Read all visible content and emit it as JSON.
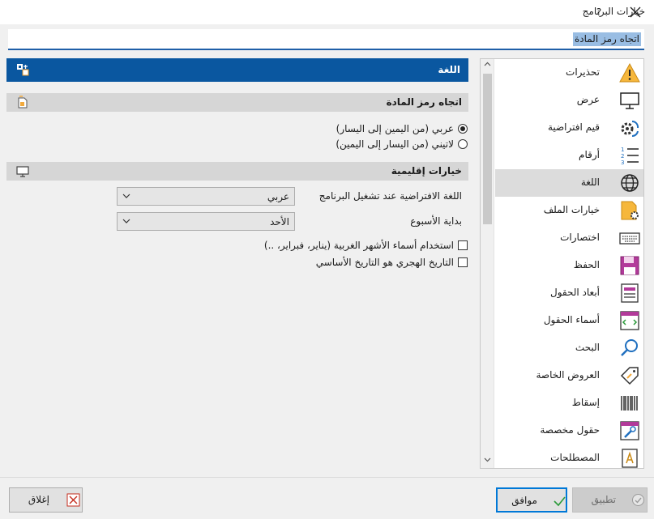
{
  "window": {
    "title": "خيارات البرنامج",
    "help_label": "?",
    "close_label": "✕"
  },
  "search": {
    "value": "اتجاه رمز المادة"
  },
  "nav": {
    "items": [
      {
        "label": "تحذيرات",
        "icon": "warning-icon"
      },
      {
        "label": "عرض",
        "icon": "monitor-icon"
      },
      {
        "label": "قيم افتراضية",
        "icon": "gear-refresh-icon"
      },
      {
        "label": "أرقام",
        "icon": "numbered-list-icon"
      },
      {
        "label": "اللغة",
        "icon": "globe-icon"
      },
      {
        "label": "خيارات الملف",
        "icon": "file-settings-icon"
      },
      {
        "label": "اختصارات",
        "icon": "keyboard-icon"
      },
      {
        "label": "الحفظ",
        "icon": "save-disk-icon"
      },
      {
        "label": "أبعاد الحقول",
        "icon": "field-dimensions-icon"
      },
      {
        "label": "أسماء الحقول",
        "icon": "field-names-icon"
      },
      {
        "label": "البحث",
        "icon": "search-icon"
      },
      {
        "label": "العروض  الخاصة",
        "icon": "tag-icon"
      },
      {
        "label": "إسقاط",
        "icon": "barcode-icon"
      },
      {
        "label": "حقول مخصصة",
        "icon": "custom-fields-icon"
      },
      {
        "label": "المصطلحات",
        "icon": "terms-icon"
      }
    ],
    "selected_index": 4
  },
  "section": {
    "title": "اللغة"
  },
  "groups": {
    "direction": {
      "title": "اتجاه رمز المادة",
      "options": [
        {
          "label": "عربي (من اليمين إلى اليسار)",
          "selected": true
        },
        {
          "label": "لاتيني (من اليسار إلى اليمين)",
          "selected": false
        }
      ]
    },
    "regional": {
      "title": "خيارات إقليمية",
      "default_language_label": "اللغة الافتراضية عند تشغيل البرنامج",
      "default_language_value": "عربي",
      "week_start_label": "بداية الأسبوع",
      "week_start_value": "الأحد",
      "checks": [
        {
          "label": "استخدام أسماء الأشهر الغربية (يناير، فبراير، ..)",
          "checked": false
        },
        {
          "label": "التاريخ الهجري هو التاريخ الأساسي",
          "checked": false
        }
      ]
    }
  },
  "buttons": {
    "close": "إغلاق",
    "ok": "موافق",
    "apply": "تطبيق"
  },
  "colors": {
    "accent": "#0a57a0",
    "selection": "#dcdcdc"
  }
}
